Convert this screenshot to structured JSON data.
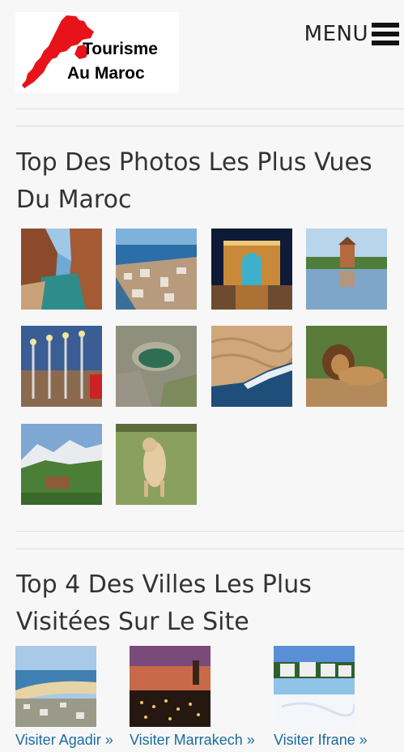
{
  "header": {
    "logo": {
      "line1": "Tourisme",
      "line2": "Au Maroc"
    },
    "menu_label": "MENU"
  },
  "photos_section": {
    "title": "Top Des Photos Les Plus Vues Du Maroc",
    "photos": [
      {
        "icon": "canyon-river-photo"
      },
      {
        "icon": "coastal-city-photo"
      },
      {
        "icon": "palace-night-photo"
      },
      {
        "icon": "menara-pavilion-photo"
      },
      {
        "icon": "lanterns-bridge-photo"
      },
      {
        "icon": "rock-pool-photo"
      },
      {
        "icon": "desert-ocean-photo"
      },
      {
        "icon": "lion-photo"
      },
      {
        "icon": "atlas-mountains-photo"
      },
      {
        "icon": "lioness-photo"
      }
    ]
  },
  "cities_section": {
    "title": "Top 4 Des Villes Les Plus Visitées Sur Le Site",
    "cities": [
      {
        "link": "Visiter Agadir »",
        "icon": "agadir-bay-photo"
      },
      {
        "link": "Visiter Marrakech »",
        "icon": "marrakech-square-photo"
      },
      {
        "link": "Visiter Ifrane »",
        "icon": "ifrane-snow-photo"
      }
    ]
  },
  "colors": {
    "background": "#f7f7f7",
    "link": "#1b6c9e",
    "divider": "#dddddd",
    "map_red": "#e8121b"
  }
}
